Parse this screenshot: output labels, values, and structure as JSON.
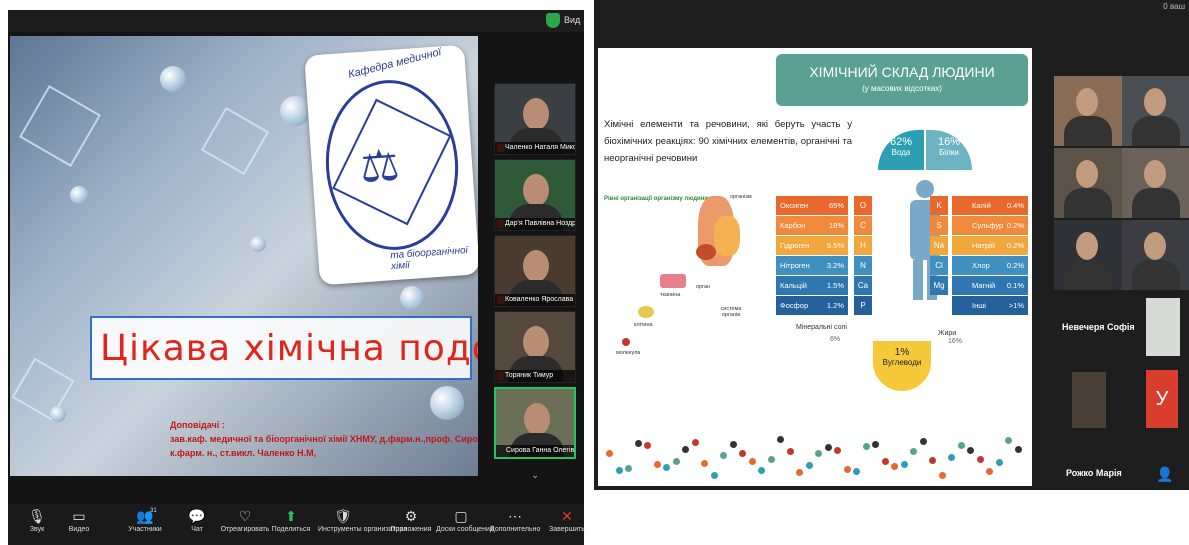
{
  "left": {
    "view_label": "Вид",
    "slide": {
      "logo_text_top": "Кафедра медичної",
      "logo_text_bottom": "та біоорганічної хімії",
      "title": "Цікава хімічна подорож",
      "reporters_heading": "Доповідачі :",
      "reporters_line1": "зав.каф. медичної та біоорганічної хімії ХНМУ, д.фарм.н.,проф. Сирова Г.О.",
      "reporters_line2": "к.фарм. н., ст.викл. Чаленко Н.М,"
    },
    "participants": [
      {
        "name": "Чаленко Наталя Микол..."
      },
      {
        "name": "Дар'я Павлівна Ноздрач..."
      },
      {
        "name": "Коваленко Ярослава"
      },
      {
        "name": "Торяник Тимур"
      },
      {
        "name": "Сирова Ганна Олегівна"
      }
    ],
    "toolbar": [
      {
        "icon": "mic-muted-icon",
        "glyph": "🎙",
        "label": "Звук"
      },
      {
        "icon": "video-icon",
        "glyph": "▭",
        "label": "Видео"
      },
      {
        "icon": "participants-icon",
        "glyph": "👥",
        "label": "Участники",
        "count": "31"
      },
      {
        "icon": "chat-icon",
        "glyph": "💬",
        "label": "Чат"
      },
      {
        "icon": "react-icon",
        "glyph": "♡",
        "label": "Отреагировать"
      },
      {
        "icon": "share-icon",
        "glyph": "⬆",
        "label": "Поделиться"
      },
      {
        "icon": "host-tools-icon",
        "glyph": "🛡",
        "label": "Инструменты организатора"
      },
      {
        "icon": "apps-icon",
        "glyph": "⚙",
        "label": "Приложения"
      },
      {
        "icon": "whiteboard-icon",
        "glyph": "▢",
        "label": "Доски сообщений"
      },
      {
        "icon": "more-icon",
        "glyph": "⋯",
        "label": "Дополнительно"
      },
      {
        "icon": "end-icon",
        "glyph": "✕",
        "label": "Завершить"
      }
    ]
  },
  "right": {
    "corner_text": "0 ваш",
    "slide": {
      "title": "ХІМІЧНИЙ СКЛАД ЛЮДИНИ",
      "subtitle": "(у масових відсотках)",
      "description": "Хімічні елементи та речовини, які беруть участь у біохімічних реакціях: 90 хімічних елементів, органічні та неорганічні речовини",
      "levels_label": "Рівні організації організму людини",
      "organism_labels": {
        "organism": "організм",
        "organ": "орган",
        "tissue": "тканина",
        "system": "система органів",
        "cell": "клітина",
        "molecule": "молекула"
      },
      "water": {
        "percent": "62%",
        "label": "Вода"
      },
      "protein": {
        "percent": "16%",
        "label": "Білки"
      },
      "carbs": {
        "percent": "1%",
        "label": "Вуглеводи"
      },
      "minerals_label": "Мінеральні солі",
      "minerals_pct": "6%",
      "fats_label": "Жири",
      "fats_pct": "16%",
      "left_elements": [
        {
          "name": "Оксиген",
          "value": "65%",
          "symbol": "O",
          "color": "#e8692b"
        },
        {
          "name": "Карбон",
          "value": "18%",
          "symbol": "C",
          "color": "#f08a3a"
        },
        {
          "name": "Гідроген",
          "value": "9.5%",
          "symbol": "H",
          "color": "#f2a73c"
        },
        {
          "name": "Нітроген",
          "value": "3.2%",
          "symbol": "N",
          "color": "#3f8fc1"
        },
        {
          "name": "Кальцій",
          "value": "1.5%",
          "symbol": "Ca",
          "color": "#2f77b0"
        },
        {
          "name": "Фосфор",
          "value": "1.2%",
          "symbol": "P",
          "color": "#24609a"
        }
      ],
      "right_elements": [
        {
          "name": "Калій",
          "value": "0.4%",
          "symbol": "K",
          "color": "#e8692b"
        },
        {
          "name": "Сульфур",
          "value": "0.2%",
          "symbol": "S",
          "color": "#f08a3a"
        },
        {
          "name": "Натрій",
          "value": "0.2%",
          "symbol": "Na",
          "color": "#f2a73c"
        },
        {
          "name": "Хлор",
          "value": "0.2%",
          "symbol": "Cl",
          "color": "#3f8fc1"
        },
        {
          "name": "Магній",
          "value": "0.1%",
          "symbol": "Mg",
          "color": "#2f77b0"
        },
        {
          "name": "Інші",
          "value": ">1%",
          "symbol": "",
          "color": "#24609a"
        }
      ]
    },
    "participants": [
      {
        "name": "Невечеря Софія"
      },
      {
        "name": "Рожко Марія"
      }
    ],
    "y_tile": "У"
  },
  "colors": {
    "accent_green": "#5ba193",
    "title_red": "#e1251b",
    "zoom_dark": "#1a1a1a"
  }
}
